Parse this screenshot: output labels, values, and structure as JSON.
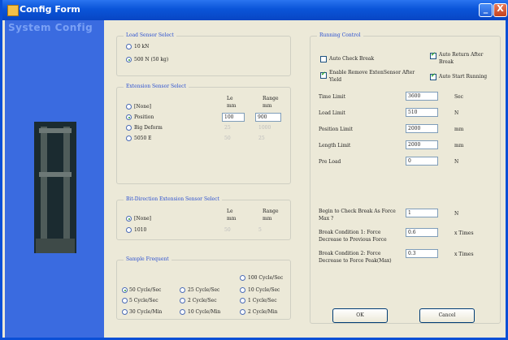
{
  "window": {
    "title": "Config Form",
    "minimize": "_",
    "close": "X"
  },
  "sidebar": {
    "title": "System Config"
  },
  "load_sensor": {
    "title": "Load Sensor Select",
    "options": [
      {
        "label": "10 kN",
        "selected": false
      },
      {
        "label": "500 N (50 kg)",
        "selected": true
      }
    ]
  },
  "extension_sensor": {
    "title": "Extension Sensor Select",
    "col_le": "Le",
    "col_range": "Range",
    "unit_le": "mm",
    "unit_range": "mm",
    "rows": [
      {
        "label": "[None]",
        "selected": false,
        "le": "",
        "range": ""
      },
      {
        "label": "Position",
        "selected": true,
        "le": "100",
        "range": "900"
      },
      {
        "label": "Big Deform",
        "selected": false,
        "le": "25",
        "range": "1000"
      },
      {
        "label": "5050 E",
        "selected": false,
        "le": "50",
        "range": "25"
      }
    ]
  },
  "bi_extension": {
    "title": "Bit-Direction Extension Sensor Select",
    "col_le": "Le",
    "col_range": "Range",
    "unit_le": "mm",
    "unit_range": "mm",
    "rows": [
      {
        "label": "[None]",
        "selected": true,
        "le": "",
        "range": ""
      },
      {
        "label": "1010",
        "selected": false,
        "le": "50",
        "range": "5"
      }
    ]
  },
  "sample_frequency": {
    "title": "Sample Frequent",
    "options": [
      {
        "label": "100 Cycle/Sec",
        "selected": false
      },
      {
        "label": "50 Cycle/Sec",
        "selected": true
      },
      {
        "label": "25 Cycle/Sec",
        "selected": false
      },
      {
        "label": "10 Cycle/Sec",
        "selected": false
      },
      {
        "label": "5 Cycle/Sec",
        "selected": false
      },
      {
        "label": "2 Cycle/Sec",
        "selected": false
      },
      {
        "label": "1 Cycle/Sec",
        "selected": false
      },
      {
        "label": "30 Cycle/Min",
        "selected": false
      },
      {
        "label": "10 Cycle/Min",
        "selected": false
      },
      {
        "label": "2 Cycle/Min",
        "selected": false
      }
    ]
  },
  "running_control": {
    "title": "Running Control",
    "checks": [
      {
        "label": "Auto Check Break",
        "checked": false
      },
      {
        "label": "Auto Return After Break",
        "checked": true
      },
      {
        "label": "Enable Remove ExtenSensor After Yield",
        "checked": true
      },
      {
        "label": "Auto Start Running",
        "checked": true
      }
    ],
    "fields": [
      {
        "label": "Time Limit",
        "value": "3600",
        "unit": "Sec"
      },
      {
        "label": "Load Limit",
        "value": "510",
        "unit": "N"
      },
      {
        "label": "Position Limit",
        "value": "2000",
        "unit": "mm"
      },
      {
        "label": "Length Limit",
        "value": "2000",
        "unit": "mm"
      },
      {
        "label": "Pre Load",
        "value": "0",
        "unit": "N"
      }
    ],
    "break_fields": [
      {
        "label": "Begin to Check Break As Force Max ?",
        "value": "1",
        "unit": "N"
      },
      {
        "label": "Break Condition 1: Force Decrease to Previous Force",
        "value": "0.6",
        "unit": "x Times"
      },
      {
        "label": "Break Condition 2: Force Decrease to Force Peak(Max)",
        "value": "0.3",
        "unit": "x Times"
      }
    ]
  },
  "buttons": {
    "ok": "OK",
    "cancel": "Cancel"
  },
  "colors": {
    "titlebar": "#0a54d8",
    "face": "#ece9d8",
    "sidebar": "#3a6be0",
    "group_title": "#2a4fd0"
  }
}
